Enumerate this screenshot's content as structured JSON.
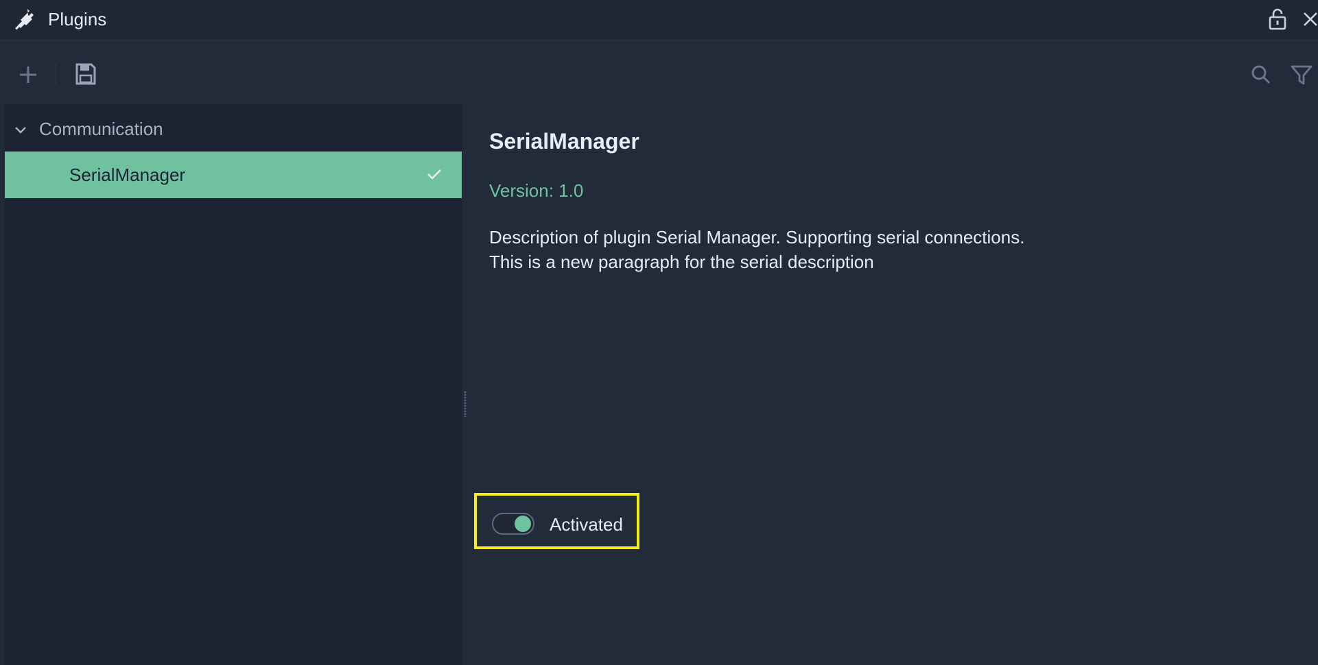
{
  "window": {
    "title": "Plugins",
    "title_icon": "plug-icon",
    "controls": {
      "lock_icon": "lock-icon",
      "close_icon": "close-icon"
    }
  },
  "toolbar": {
    "add_icon": "plus-icon",
    "save_icon": "save-icon",
    "search_icon": "search-icon",
    "filter_icon": "filter-icon"
  },
  "sidebar": {
    "groups": [
      {
        "label": "Communication",
        "expanded": true,
        "items": [
          {
            "label": "SerialManager",
            "selected": true,
            "activated": true
          }
        ]
      }
    ]
  },
  "detail": {
    "title": "SerialManager",
    "version_text": "Version: 1.0",
    "description": "Description of plugin Serial Manager. Supporting serial connections.\nThis is a new paragraph for the serial description",
    "activation": {
      "label": "Activated",
      "on": true
    }
  },
  "colors": {
    "background": "#222b3a",
    "sidebar": "#1c2433",
    "accent": "#6fc1a0",
    "highlight_border": "#f5ee1a"
  }
}
